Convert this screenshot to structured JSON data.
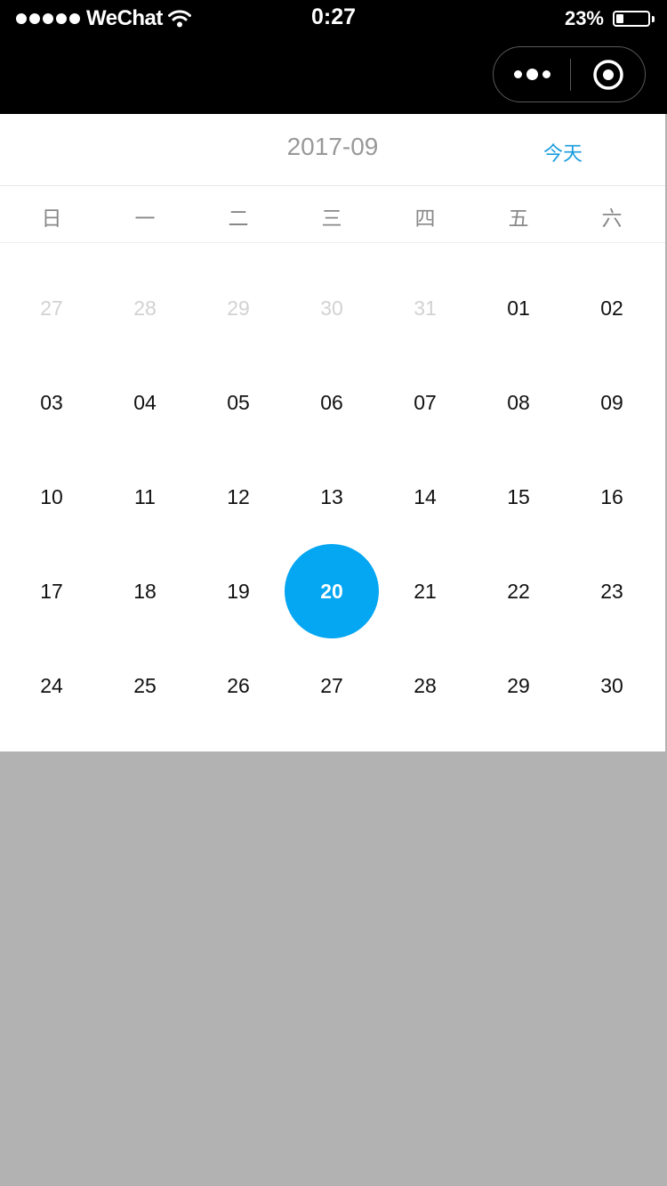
{
  "status_bar": {
    "carrier": "WeChat",
    "time": "0:27",
    "battery_percent": "23%",
    "battery_level": 0.23,
    "signal_bars": 5
  },
  "capsule": {
    "more_icon": "more-dots-icon",
    "close_icon": "target-icon"
  },
  "calendar": {
    "month_title": "2017-09",
    "today_label": "今天",
    "weekdays": [
      "日",
      "一",
      "二",
      "三",
      "四",
      "五",
      "六"
    ],
    "accent_color": "#05a6f2",
    "weeks": [
      [
        {
          "d": "27",
          "m": true
        },
        {
          "d": "28",
          "m": true
        },
        {
          "d": "29",
          "m": true
        },
        {
          "d": "30",
          "m": true
        },
        {
          "d": "31",
          "m": true
        },
        {
          "d": "01"
        },
        {
          "d": "02"
        }
      ],
      [
        {
          "d": "03"
        },
        {
          "d": "04"
        },
        {
          "d": "05"
        },
        {
          "d": "06"
        },
        {
          "d": "07"
        },
        {
          "d": "08"
        },
        {
          "d": "09"
        }
      ],
      [
        {
          "d": "10"
        },
        {
          "d": "11"
        },
        {
          "d": "12"
        },
        {
          "d": "13"
        },
        {
          "d": "14"
        },
        {
          "d": "15"
        },
        {
          "d": "16"
        }
      ],
      [
        {
          "d": "17"
        },
        {
          "d": "18"
        },
        {
          "d": "19"
        },
        {
          "d": "20",
          "s": true
        },
        {
          "d": "21"
        },
        {
          "d": "22"
        },
        {
          "d": "23"
        }
      ],
      [
        {
          "d": "24"
        },
        {
          "d": "25"
        },
        {
          "d": "26"
        },
        {
          "d": "27"
        },
        {
          "d": "28"
        },
        {
          "d": "29"
        },
        {
          "d": "30"
        }
      ]
    ]
  }
}
